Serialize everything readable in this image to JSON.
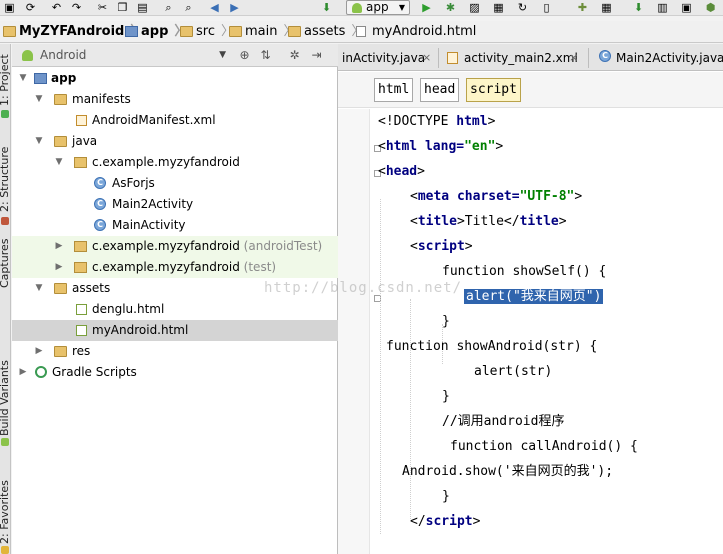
{
  "toolbar": {
    "run_config": "app",
    "icons": [
      "save-icon",
      "sync-icon",
      "cut-icon",
      "copy-icon",
      "paste-icon",
      "find-icon",
      "replace-icon",
      "back-icon",
      "forward-icon",
      "make-icon",
      "run-icon",
      "debug-icon",
      "attach-icon",
      "sdk-manager-icon",
      "avd-manager-icon",
      "sync-gradle-icon",
      "monitor-icon"
    ]
  },
  "breadcrumb": {
    "items": [
      "MyZYFAndroid",
      "app",
      "src",
      "main",
      "assets",
      "myAndroid.html"
    ]
  },
  "left_strip": {
    "labels": [
      "1: Project",
      "2: Structure",
      "Captures",
      "Build Variants",
      "2: Favorites"
    ]
  },
  "project_panel": {
    "view_mode": "Android"
  },
  "tree": [
    {
      "label": "app",
      "bold": true,
      "icon": "module-folder-icon",
      "expanded": true
    },
    {
      "label": "manifests",
      "icon": "folder-icon",
      "expanded": true
    },
    {
      "label": "AndroidManifest.xml",
      "icon": "xml-file-icon"
    },
    {
      "label": "java",
      "icon": "folder-icon",
      "expanded": true
    },
    {
      "label": "c.example.myzyfandroid",
      "icon": "package-icon",
      "expanded": true
    },
    {
      "label": "AsForjs",
      "icon": "class-icon"
    },
    {
      "label": "Main2Activity",
      "icon": "class-icon"
    },
    {
      "label": "MainActivity",
      "icon": "class-icon"
    },
    {
      "label": "c.example.myzyfandroid",
      "suffix": "(androidTest)",
      "icon": "package-icon",
      "expanded": false
    },
    {
      "label": "c.example.myzyfandroid",
      "suffix": "(test)",
      "icon": "package-icon",
      "expanded": false
    },
    {
      "label": "assets",
      "icon": "folder-icon",
      "expanded": true
    },
    {
      "label": "denglu.html",
      "icon": "html-file-icon"
    },
    {
      "label": "myAndroid.html",
      "icon": "html-file-icon",
      "selected": true
    },
    {
      "label": "res",
      "icon": "folder-icon",
      "expanded": false
    },
    {
      "label": "Gradle Scripts",
      "icon": "gradle-icon",
      "expanded": false
    }
  ],
  "tabs": [
    {
      "label": "inActivity.java"
    },
    {
      "label": "activity_main2.xml"
    },
    {
      "label": "Main2Activity.java"
    }
  ],
  "tag_breadcrumb": [
    "html",
    "head",
    "script"
  ],
  "code": {
    "l1": "<!DOCTYPE ",
    "l1b": "html",
    "l2a": "<",
    "l2b": "html ",
    "l2c": "lang=",
    "l2d": "\"en\"",
    "l2e": ">",
    "l3a": "<",
    "l3b": "head",
    "l3c": ">",
    "l4a": "<",
    "l4b": "meta ",
    "l4c": "charset=",
    "l4d": "\"UTF-8\"",
    "l4e": ">",
    "l5a": "<",
    "l5b": "title",
    "l5c": ">Title</",
    "l5d": "title",
    "l5e": ">",
    "l6a": "<",
    "l6b": "script",
    "l6c": ">",
    "l7": "function showSelf() {",
    "l8": "alert(\"我来自网页\")",
    "l9": "}",
    "l10": "function showAndroid(str) {",
    "l11": "alert(str)",
    "l12": "}",
    "l13": "//调用android程序",
    "l14": "function callAndroid() {",
    "l15": "Android.show('来自网页的我');",
    "l16": "}",
    "l17a": "</",
    "l17b": "script",
    "l17c": ">"
  },
  "watermark": "http://blog.csdn.net/",
  "colors": {
    "selection": "#2f64ad",
    "tree_selected": "#d4d4d4",
    "test_row": "#f0f9e8",
    "keyword": "#000080",
    "string": "#008000"
  }
}
